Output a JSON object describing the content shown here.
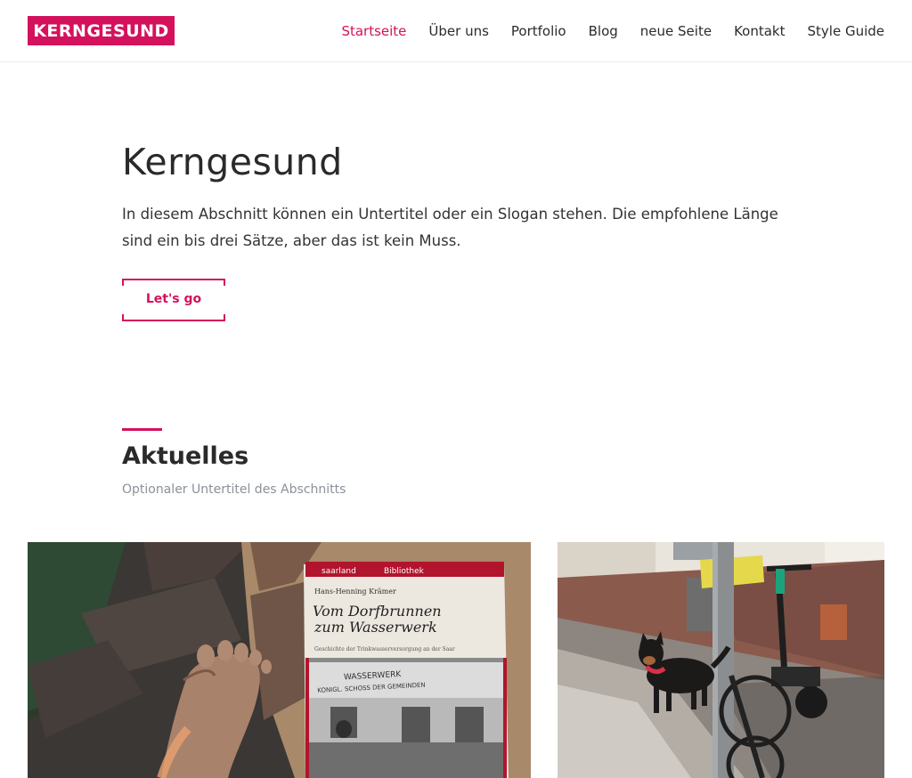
{
  "brand": {
    "logo_text": "KERNGESUND",
    "accent_color": "#d4115c"
  },
  "nav": {
    "items": [
      {
        "label": "Startseite",
        "active": true
      },
      {
        "label": "Über uns",
        "active": false
      },
      {
        "label": "Portfolio",
        "active": false
      },
      {
        "label": "Blog",
        "active": false
      },
      {
        "label": "neue Seite",
        "active": false
      },
      {
        "label": "Kontakt",
        "active": false
      },
      {
        "label": "Style Guide",
        "active": false
      }
    ]
  },
  "hero": {
    "title": "Kerngesund",
    "subtitle": "In diesem Abschnitt können ein Untertitel oder ein Slogan stehen. Die empfohlene Länge sind ein bis drei Sätze, aber das ist kein Muss.",
    "cta_label": "Let's go"
  },
  "news": {
    "title": "Aktuelles",
    "subtitle": "Optionaler Untertitel des Abschnitts"
  },
  "cards": [
    {
      "image": "photo-foot-and-book",
      "book": {
        "series_left": "saarland",
        "series_right": "Bibliothek",
        "author": "Hans-Henning Krämer",
        "title_line1": "Vom Dorfbrunnen",
        "title_line2": "zum Wasserwerk",
        "subtitle": "Geschichte der Trinkwasserversorgung an der Saar",
        "sign_line1": "WASSERWERK",
        "sign_line2": "KONIGL. SCHOSS DER GEMEINDEN"
      }
    },
    {
      "image": "photo-dog-and-scooter"
    }
  ]
}
